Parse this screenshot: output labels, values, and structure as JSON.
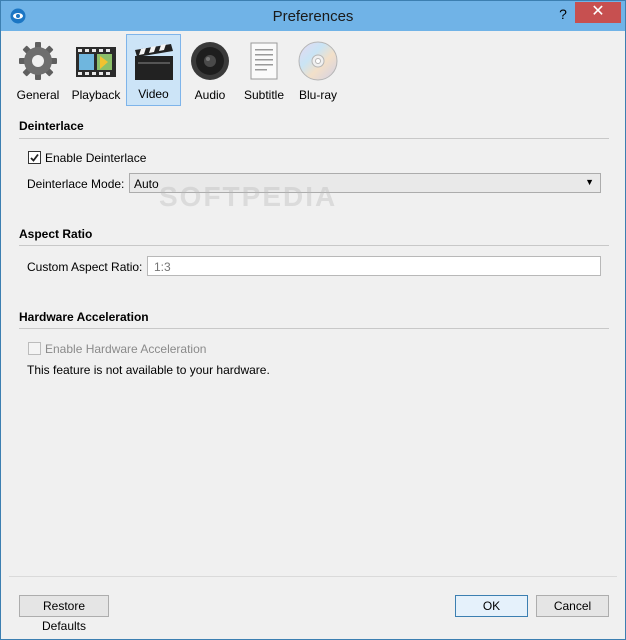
{
  "window": {
    "title": "Preferences",
    "help_label": "?",
    "close_label": "✕"
  },
  "toolbar": {
    "items": [
      {
        "label": "General",
        "icon": "gear-icon"
      },
      {
        "label": "Playback",
        "icon": "film-icon"
      },
      {
        "label": "Video",
        "icon": "clapperboard-icon",
        "active": true
      },
      {
        "label": "Audio",
        "icon": "speaker-icon"
      },
      {
        "label": "Subtitle",
        "icon": "document-icon"
      },
      {
        "label": "Blu-ray",
        "icon": "disc-icon"
      }
    ]
  },
  "deinterlace": {
    "title": "Deinterlace",
    "enable_label": "Enable Deinterlace",
    "enable_checked": true,
    "mode_label": "Deinterlace Mode:",
    "mode_value": "Auto"
  },
  "aspect_ratio": {
    "title": "Aspect Ratio",
    "custom_label": "Custom Aspect Ratio:",
    "custom_placeholder": "1:3"
  },
  "hardware": {
    "title": "Hardware Acceleration",
    "enable_label": "Enable Hardware Acceleration",
    "enable_checked": false,
    "note": "This feature is not available to your hardware."
  },
  "buttons": {
    "restore": "Restore Defaults",
    "ok": "OK",
    "cancel": "Cancel"
  },
  "watermark": "SOFTPEDIA",
  "colors": {
    "titlebar": "#70b3e7",
    "close": "#c75050",
    "active_tab": "#cce4f7"
  }
}
